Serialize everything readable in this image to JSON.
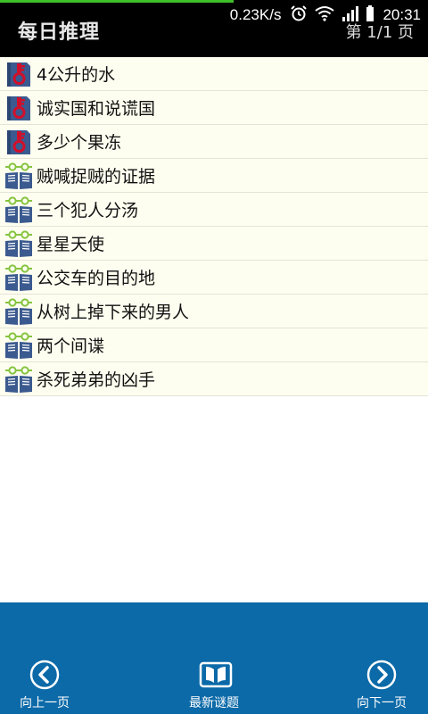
{
  "status": {
    "speed": "0.23K/s",
    "time": "20:31"
  },
  "header": {
    "title": "每日推理",
    "page": "第 1/1 页"
  },
  "items": [
    {
      "label": "4公升的水",
      "icon": "key-book-icon"
    },
    {
      "label": "诚实国和说谎国",
      "icon": "key-book-icon"
    },
    {
      "label": "多少个果冻",
      "icon": "key-book-icon"
    },
    {
      "label": "贼喊捉贼的证据",
      "icon": "glasses-book-icon"
    },
    {
      "label": "三个犯人分汤",
      "icon": "glasses-book-icon"
    },
    {
      "label": "星星天使",
      "icon": "glasses-book-icon"
    },
    {
      "label": "公交车的目的地",
      "icon": "glasses-book-icon"
    },
    {
      "label": "从树上掉下来的男人",
      "icon": "glasses-book-icon"
    },
    {
      "label": "两个间谍",
      "icon": "glasses-book-icon"
    },
    {
      "label": "杀死弟弟的凶手",
      "icon": "glasses-book-icon"
    }
  ],
  "nav": {
    "prev": "向上一页",
    "latest": "最新谜题",
    "next": "向下一页"
  },
  "colors": {
    "header": "#000000",
    "list_bg": "#fefef0",
    "bottom": "#0c6aa8",
    "icon_blue": "#3b5a8f",
    "key_red": "#d0102a",
    "glasses_green": "#86c441"
  }
}
